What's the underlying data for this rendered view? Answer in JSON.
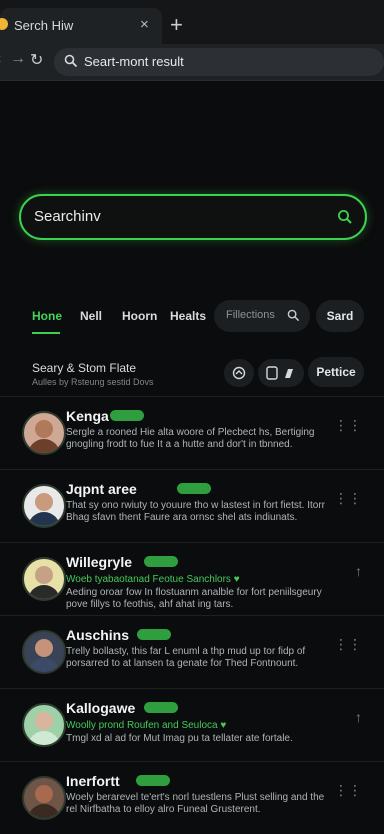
{
  "browser": {
    "tab_title": "Serch Hiw",
    "close_glyph": "×",
    "new_tab_glyph": "+",
    "url": "Seart-mont result"
  },
  "search": {
    "value": "Searchinv"
  },
  "filters": {
    "tabs": [
      "Hone",
      "Nell",
      "Hoorn",
      "Healts"
    ],
    "active_tab": "Hone",
    "input_placeholder": "Fillections",
    "save_label": "Sard"
  },
  "section": {
    "title": "Seary & Stom Flate",
    "subtitle": "Aulles by Rsteung sestid Dovs",
    "refine_label": "Pettice"
  },
  "results": [
    {
      "name": "Kenga",
      "tag": "",
      "meta": "",
      "description": "Sergle a rooned Hie alta woore of Plecbect hs, Bertiging gnogling frodt to fue It a a hutte and dor't in tbnned.",
      "action": "⋮⋮",
      "avatar_skin": "#b07a5a",
      "avatar_bg": "#cfa895",
      "avatar_body": "#6b3f2a"
    },
    {
      "name": "Jqpnt aree",
      "tag": "",
      "meta": "",
      "description": "That sy ono rwiuty to youure tho w lastest in fort fietst. Itorr Bhag sfavn thent Faure ara ornsc shel ats indiunats.",
      "action": "⋮⋮",
      "avatar_skin": "#c99a7c",
      "avatar_bg": "#e9e9e9",
      "avatar_body": "#23344f"
    },
    {
      "name": "Willegryle",
      "tag": "",
      "meta": "Woeb tyabaotanad Feotue Sanchlors ♥",
      "description": "Aeding oroar fow In flostuanm analble for fort peniilsgeury pove fillys to feothis, ahf ahat ing tars.",
      "action": "↑",
      "avatar_skin": "#c7a186",
      "avatar_bg": "#e7e1a8",
      "avatar_body": "#2a2a2a"
    },
    {
      "name": "Auschins",
      "tag": "",
      "meta": "",
      "description": "Trelly bollasty, this far L enuml a thp mud up tor fidp of porsarred to at lansen ta genate for Thed Fontnount.",
      "action": "⋮⋮",
      "avatar_skin": "#c5927a",
      "avatar_bg": "#3a4356",
      "avatar_body": "#3b4a66"
    },
    {
      "name": "Kallogawe",
      "tag": "",
      "meta": "Woolly prond Roufen and Seuloca ♥",
      "description": "Tmgl xd al ad for Mut Imag pu ta tellater ate fortale.",
      "action": "↑",
      "avatar_skin": "#d9b59e",
      "avatar_bg": "#9fd1a8",
      "avatar_body": "#cfe9d3"
    },
    {
      "name": "Inerfortt",
      "tag": "",
      "meta": "",
      "description": "Woely berarevel te'ert's norl tuestlens Plust selling and the rel Nirfbatha to elloy alro Funeal Grusterent.",
      "action": "⋮⋮",
      "avatar_skin": "#a8694e",
      "avatar_bg": "#6e5548",
      "avatar_body": "#3b2a22"
    }
  ],
  "colors": {
    "accent": "#3ad24e",
    "background": "#0b0c0d",
    "surface": "#1c1f22"
  }
}
